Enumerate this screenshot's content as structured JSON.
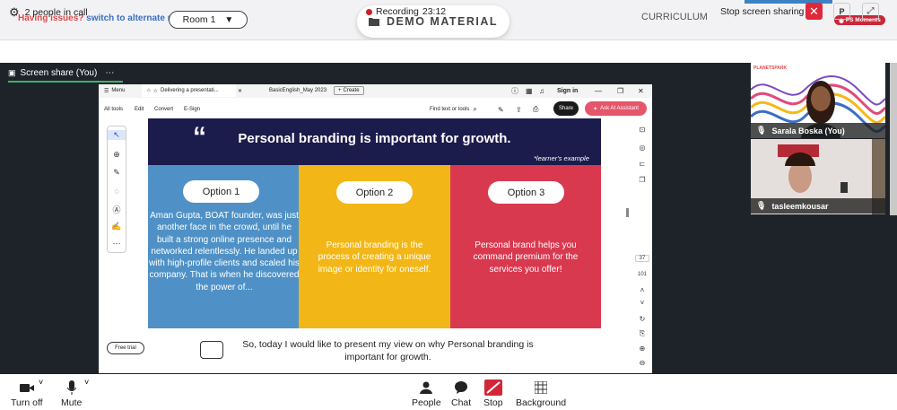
{
  "topbar": {
    "issue_text": "Having issues?",
    "alt_room_link": "switch to alternate room",
    "room_select": "Room 1",
    "demo_label": "DEMO MATERIAL",
    "curriculum_label": "CURRICULUM",
    "moments_label": "PS Moments"
  },
  "callbar": {
    "people_count": "2 people in call",
    "recording_label": "Recording",
    "recording_time": "23:12",
    "stop_sharing": "Stop screen sharing",
    "p_button": "P"
  },
  "screen_share": {
    "tab_label": "Screen share (You)"
  },
  "browser": {
    "menu_label": "Menu",
    "tab1": "Delivering a presentati...",
    "tab2": "BasicEnglish_May 2023",
    "create_label": "Create",
    "sign_in": "Sign in",
    "menus": [
      "All tools",
      "Edit",
      "Convert",
      "E-Sign"
    ],
    "find_text": "Find text or tools",
    "share_label": "Share",
    "ai_label": "Ask AI Assistant",
    "free_trial": "Free trial",
    "page_num": "37",
    "page_total": "101"
  },
  "slide": {
    "title": "Personal branding is important for growth.",
    "subnote": "*learner's example",
    "columns": [
      {
        "label": "Option 1",
        "text": "Aman Gupta, BOAT founder, was just another face in the crowd, until he built a strong online presence and networked relentlessly. He landed up with high-profile clients and scaled his company. That is when he discovered the power of...",
        "color": "#4f91c6"
      },
      {
        "label": "Option 2",
        "text": "Personal branding is the process of creating a unique image or identity for oneself.",
        "color": "#f2b716"
      },
      {
        "label": "Option 3",
        "text": "Personal brand helps you command premium for the services you offer!",
        "color": "#d9394f"
      }
    ],
    "bottom_text": "So, today I would like to present my view on why Personal branding is important for growth."
  },
  "participants": [
    {
      "name": "Sarala Boska (You)",
      "logo": "PLANETSPARK"
    },
    {
      "name": "tasleemkousar"
    }
  ],
  "controls": {
    "turn_off": "Turn off",
    "mute": "Mute",
    "people": "People",
    "chat": "Chat",
    "stop": "Stop",
    "background": "Background"
  },
  "colors": {
    "accent_red": "#e0283b",
    "recording": "#d01c2c",
    "screen_green": "#3db46a",
    "slide_header": "#1b1b4c"
  }
}
